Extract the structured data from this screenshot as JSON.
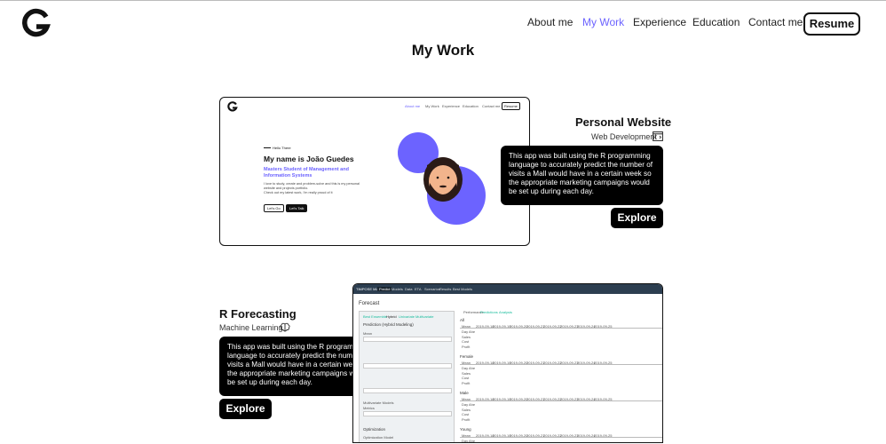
{
  "nav": {
    "items": [
      "About me",
      "My Work",
      "Experience",
      "Education",
      "Contact me"
    ],
    "active": "My Work",
    "resume": "Resume"
  },
  "page_title": "My Work",
  "projects": [
    {
      "title": "Personal Website",
      "category": "Web Development",
      "icon": "code-window-icon",
      "tooltip": "This app was built using the R programming language to accurately predict the number of visits a Mall would have in a certain week so the appropriate marketing campaigns would be set up during each day.",
      "button": "Explore"
    },
    {
      "title": "R Forecasting",
      "category": "Machine Learning",
      "icon": "brain-icon",
      "tooltip": "This app was built using the R programming language to accurately predict the number of visits a Mall would have in a certain week so the appropriate marketing campaigns would be set up during each day.",
      "button": "Explore"
    }
  ],
  "preview1": {
    "nav": [
      "About me",
      "My Work",
      "Experience",
      "Education",
      "Contact me"
    ],
    "resume": "Resume",
    "hello": "Hello There",
    "name": "My name is João Guedes",
    "degree": "Masters Student of Management and Information Systems",
    "desc": "I love to study, create and problem-solve and this is my personal website and projects portfolio.",
    "desc2": "Check out my latest work, I'm really proud of it",
    "btn1": "Let's Go",
    "btn2": "Let's Talk",
    "colors": {
      "accent": "#6c63ff",
      "blob": "#6c63ff"
    }
  },
  "preview2": {
    "brand": "TIMPOSE ML",
    "tabs": [
      "Predict",
      "Models",
      "Data",
      "ETA",
      "Scenarios",
      "Results",
      "Best Models"
    ],
    "section": "Forecast",
    "subtabs": [
      "Best Ensemble",
      "Hybrid",
      "Univariate",
      "Multivariate"
    ],
    "panel_title": "Prediction (Hybrid Modeling)",
    "panel_fields": [
      "Mean",
      "Multivariate Models",
      "Metrics",
      "Optimization",
      "Optimization Model"
    ],
    "table_tabs": [
      "Performance",
      "Predictions",
      "Analysis"
    ],
    "groups": [
      "All",
      "Female",
      "Male",
      "Young"
    ],
    "header": [
      "Mean",
      "2019-09-18",
      "2019-09-19",
      "2019-09-20",
      "2019-09-21",
      "2019-09-22",
      "2019-09-23",
      "2019-09-24",
      "2019-09-25"
    ],
    "rows": [
      "Day Ahe",
      "Sales",
      "Cost",
      "Profit"
    ]
  }
}
